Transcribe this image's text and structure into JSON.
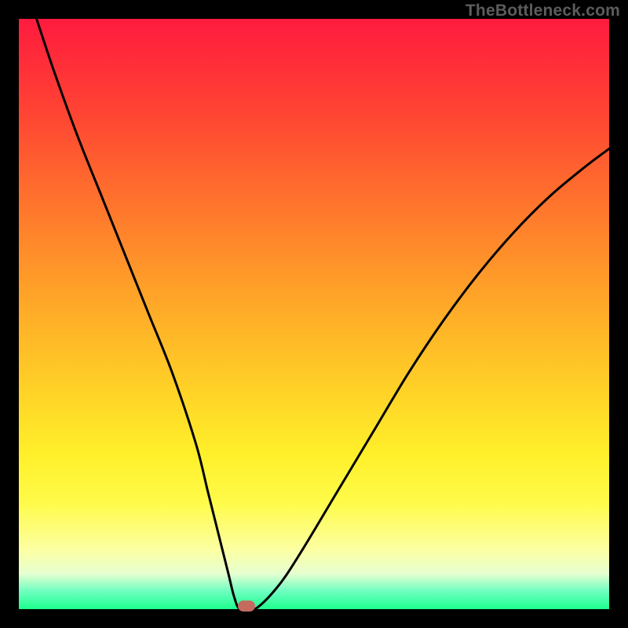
{
  "watermark": "TheBottleneck.com",
  "chart_data": {
    "type": "line",
    "title": "",
    "xlabel": "",
    "ylabel": "",
    "xlim": [
      0,
      100
    ],
    "ylim": [
      0,
      100
    ],
    "x": [
      3,
      6,
      10,
      14,
      18,
      22,
      26,
      30,
      32,
      34,
      35.5,
      36.5,
      37.5,
      40,
      44,
      48,
      54,
      60,
      66,
      72,
      78,
      84,
      90,
      96,
      100
    ],
    "values": [
      100,
      91,
      80,
      70,
      60,
      50,
      40,
      28,
      20,
      12,
      6,
      2,
      0,
      0,
      4,
      10,
      20,
      30,
      40,
      49,
      57,
      64,
      70,
      75,
      78
    ],
    "marker": {
      "x_pct": 38.5,
      "y_pct": 0.5
    },
    "gradient_stops": [
      {
        "pct": 0,
        "color": "#ff1b3f"
      },
      {
        "pct": 16,
        "color": "#ff4433"
      },
      {
        "pct": 40,
        "color": "#ff8f2a"
      },
      {
        "pct": 64,
        "color": "#ffd527"
      },
      {
        "pct": 82,
        "color": "#fffb4a"
      },
      {
        "pct": 94,
        "color": "#e6ffd0"
      },
      {
        "pct": 100,
        "color": "#1dff8d"
      }
    ]
  }
}
